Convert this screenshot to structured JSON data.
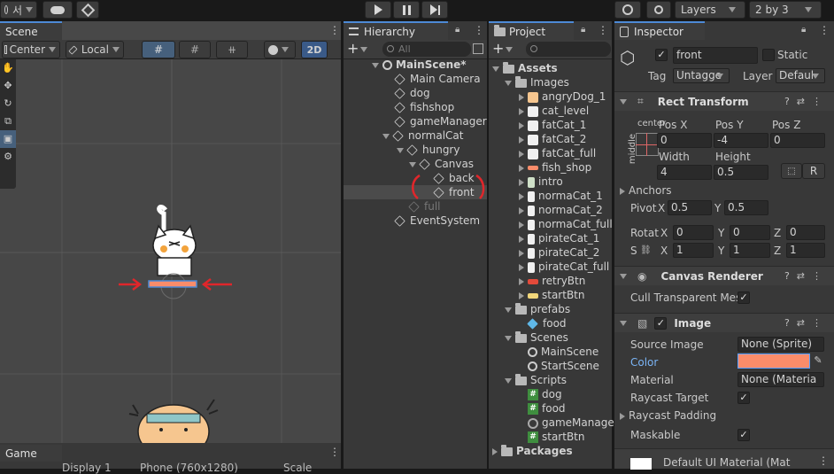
{
  "toolbar": {
    "account_label": "서",
    "layers_label": "Layers",
    "layout_label": "2 by 3"
  },
  "scene": {
    "tab_label": "Scene",
    "pivot_label": "Center",
    "space_label": "Local",
    "mode_2d": "2D"
  },
  "game": {
    "tab_label": "Game",
    "display_label": "Display 1",
    "resolution_label": "Phone (760x1280)",
    "scale_label": "Scale"
  },
  "hierarchy": {
    "tab_label": "Hierarchy",
    "search_placeholder": "All",
    "items": [
      {
        "label": "MainScene*"
      },
      {
        "label": "Main Camera"
      },
      {
        "label": "dog"
      },
      {
        "label": "fishshop"
      },
      {
        "label": "gameManager"
      },
      {
        "label": "normalCat"
      },
      {
        "label": "hungry"
      },
      {
        "label": "Canvas"
      },
      {
        "label": "back"
      },
      {
        "label": "front"
      },
      {
        "label": "full"
      },
      {
        "label": "EventSystem"
      }
    ]
  },
  "project": {
    "tab_label": "Project",
    "items": [
      {
        "label": "Assets"
      },
      {
        "label": "Images"
      },
      {
        "label": "angryDog_1"
      },
      {
        "label": "cat_level"
      },
      {
        "label": "fatCat_1"
      },
      {
        "label": "fatCat_2"
      },
      {
        "label": "fatCat_full"
      },
      {
        "label": "fish_shop"
      },
      {
        "label": "intro"
      },
      {
        "label": "normaCat_1"
      },
      {
        "label": "normaCat_2"
      },
      {
        "label": "normaCat_full"
      },
      {
        "label": "pirateCat_1"
      },
      {
        "label": "pirateCat_2"
      },
      {
        "label": "pirateCat_full"
      },
      {
        "label": "retryBtn"
      },
      {
        "label": "startBtn"
      },
      {
        "label": "prefabs"
      },
      {
        "label": "food"
      },
      {
        "label": "Scenes"
      },
      {
        "label": "MainScene"
      },
      {
        "label": "StartScene"
      },
      {
        "label": "Scripts"
      },
      {
        "label": "dog"
      },
      {
        "label": "food"
      },
      {
        "label": "gameManage"
      },
      {
        "label": "startBtn"
      },
      {
        "label": "Packages"
      }
    ]
  },
  "inspector": {
    "tab_label": "Inspector",
    "object_name": "front",
    "static_label": "Static",
    "tag_label": "Tag",
    "tag_value": "Untagge",
    "layer_label": "Layer",
    "layer_value": "Defaul",
    "rect_transform": {
      "title": "Rect Transform",
      "anchor_h": "center",
      "anchor_v": "middle",
      "pos_x_label": "Pos X",
      "pos_x": "0",
      "pos_y_label": "Pos Y",
      "pos_y": "-4",
      "pos_z_label": "Pos Z",
      "pos_z": "0",
      "width_label": "Width",
      "width": "4",
      "height_label": "Height",
      "height": "0.5",
      "r_button": "R",
      "anchors_label": "Anchors",
      "pivot_label": "Pivot",
      "pivot_x": "0.5",
      "pivot_y": "0.5",
      "rotation_label": "Rotat",
      "rot_x": "0",
      "rot_y": "0",
      "rot_z": "0",
      "scale_label": "S",
      "scale_x": "1",
      "scale_y": "1",
      "scale_z": "1",
      "x_axis": "X",
      "y_axis": "Y",
      "z_axis": "Z"
    },
    "canvas_renderer": {
      "title": "Canvas Renderer",
      "cull_label": "Cull Transparent Mes"
    },
    "image": {
      "title": "Image",
      "source_label": "Source Image",
      "source_value": "None (Sprite)",
      "color_label": "Color",
      "color_value": "#fa8c6a",
      "material_label": "Material",
      "material_value": "None (Materia",
      "raycast_label": "Raycast Target",
      "padding_label": "Raycast Padding",
      "maskable_label": "Maskable"
    },
    "footer_material": "Default UI Material (Mat"
  },
  "colors": {
    "accent": "#4d8ad6",
    "selection": "#4b4b4b",
    "swatch": "#fa8c6a",
    "annotation_red": "#e0262b"
  }
}
